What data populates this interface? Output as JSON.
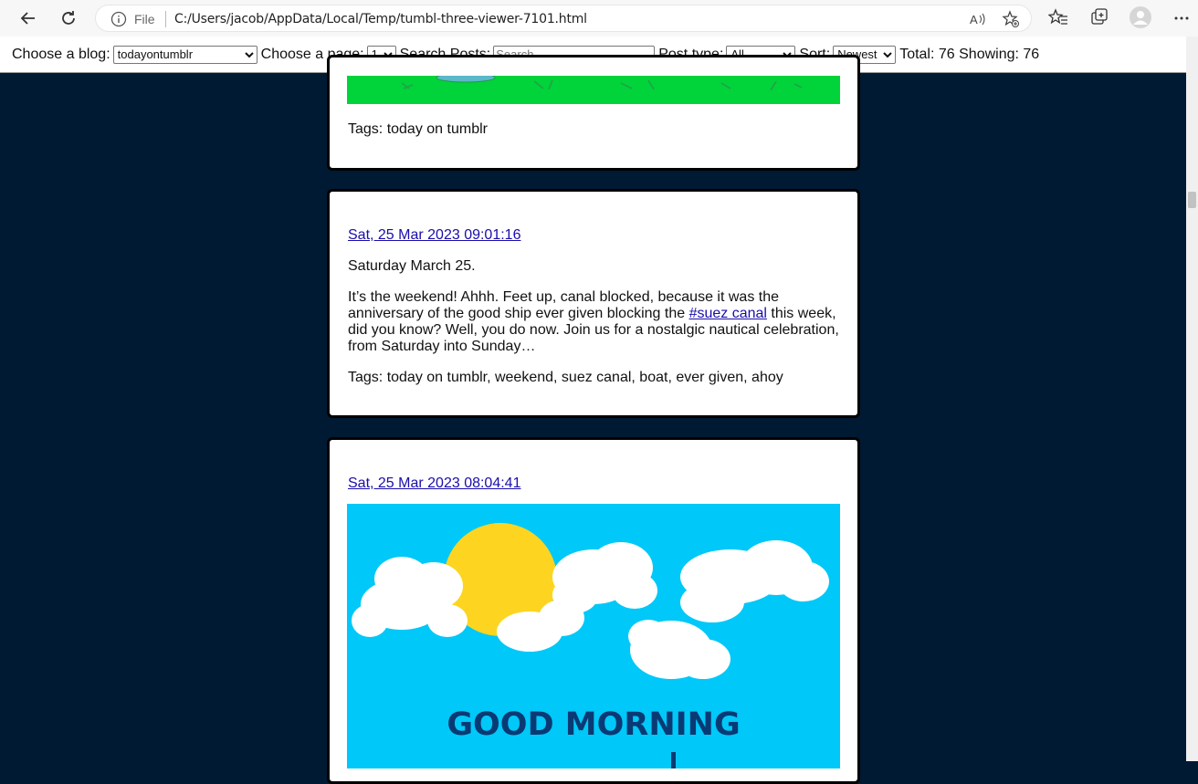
{
  "browser": {
    "file_label": "File",
    "url": "C:/Users/jacob/AppData/Local/Temp/tumbl-three-viewer-7101.html"
  },
  "toolbar": {
    "blog_label": "Choose a blog:",
    "blog_value": "todayontumblr",
    "page_label": "Choose a page:",
    "page_value": "1",
    "search_label": "Search Posts:",
    "search_placeholder": "Search...",
    "type_label": "Post type:",
    "type_value": "All",
    "sort_label": "Sort:",
    "sort_value": "Newest",
    "total_text": "Total: 76 Showing: 76"
  },
  "posts": [
    {
      "tags": "Tags: today on tumblr"
    },
    {
      "date": "Sat, 25 Mar 2023 09:01:16",
      "line1": "Saturday March 25.",
      "body_before": "It’s the weekend! Ahhh. Feet up, canal blocked, because it was the anniversary of the good ship ever given blocking the ",
      "body_link": "#suez canal",
      "body_after": " this week, did you know? Well, you do now. Join us for a nostalgic nautical celebration, from Saturday into Sunday…",
      "tags": "Tags: today on tumblr, weekend, suez canal, boat, ever given, ahoy"
    },
    {
      "date": "Sat, 25 Mar 2023 08:04:41",
      "image_text": "GOOD MORNING"
    }
  ],
  "colors": {
    "page_bg": "#001a33",
    "link": "#1a0dab",
    "green_image": "#00d43a",
    "sky_image": "#00c8f8",
    "sun": "#fdd520",
    "good_morning_text": "#0a3a74"
  }
}
